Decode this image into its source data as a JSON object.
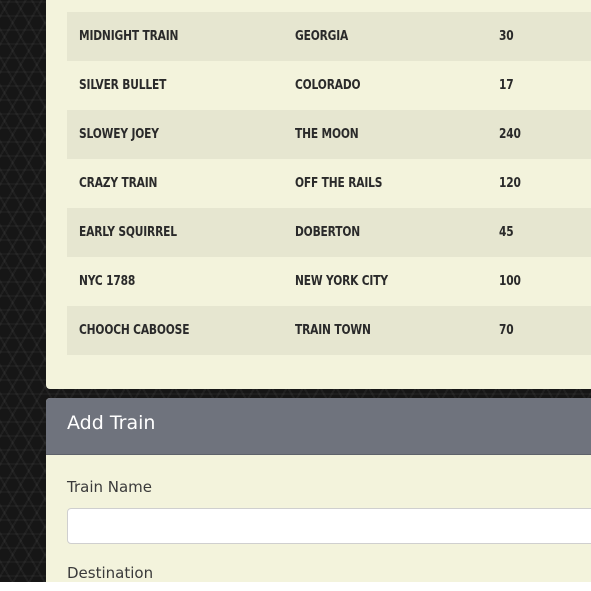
{
  "trains_table": {
    "rows": [
      {
        "name": "MIDNIGHT TRAIN",
        "destination": "GEORGIA",
        "frequency": "30"
      },
      {
        "name": "SILVER BULLET",
        "destination": "COLORADO",
        "frequency": "17"
      },
      {
        "name": "SLOWEY JOEY",
        "destination": "THE MOON",
        "frequency": "240"
      },
      {
        "name": "CRAZY TRAIN",
        "destination": "OFF THE RAILS",
        "frequency": "120"
      },
      {
        "name": "EARLY SQUIRREL",
        "destination": "DOBERTON",
        "frequency": "45"
      },
      {
        "name": "NYC 1788",
        "destination": "NEW YORK CITY",
        "frequency": "100"
      },
      {
        "name": "CHOOCH CABOOSE",
        "destination": "TRAIN TOWN",
        "frequency": "70"
      }
    ]
  },
  "add_train": {
    "title": "Add Train",
    "fields": {
      "train_name_label": "Train Name",
      "train_name_value": "",
      "destination_label": "Destination"
    }
  },
  "colors": {
    "card_background": "#f3f3dc",
    "row_striped": "#e6e6d0",
    "header_background": "#6f737d",
    "page_background": "#161616"
  }
}
